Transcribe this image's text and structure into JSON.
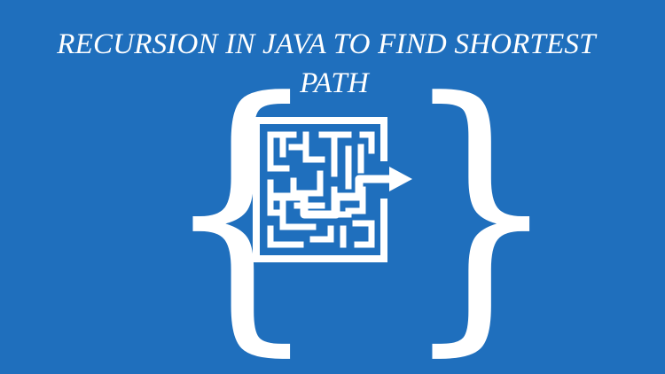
{
  "title": {
    "line1": "RECURSION IN JAVA TO FIND SHORTEST",
    "line2": "PATH"
  },
  "logo": {
    "left_brace": "{",
    "right_brace": "}",
    "icon": "maze-icon"
  },
  "colors": {
    "background": "#1f6fbd",
    "foreground": "#ffffff"
  }
}
